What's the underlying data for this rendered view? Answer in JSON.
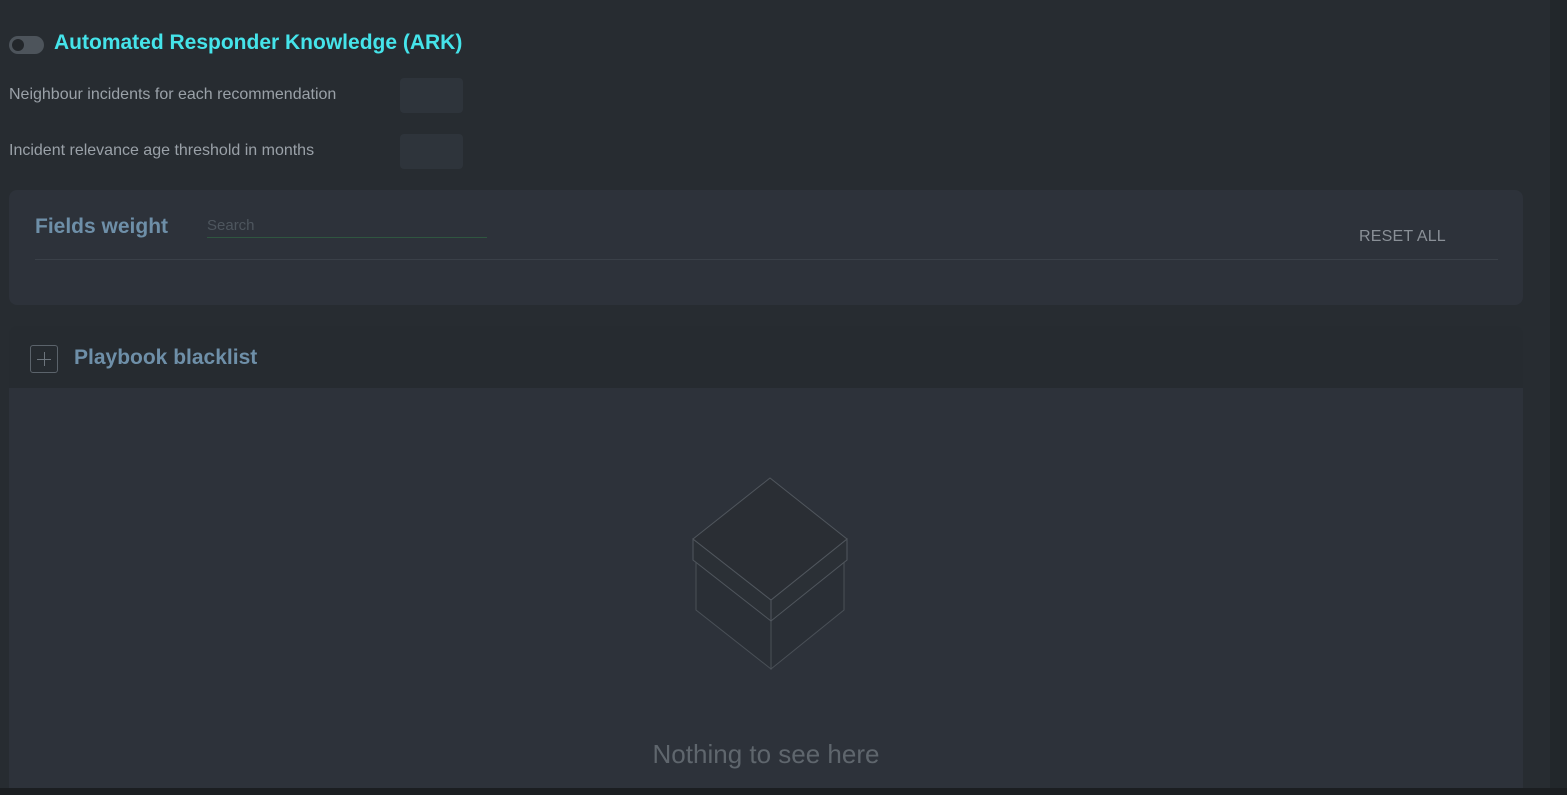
{
  "ark": {
    "title": "Automated Responder Knowledge (ARK)",
    "enabled": false,
    "settings": [
      {
        "label": "Neighbour incidents for each recommendation",
        "value": ""
      },
      {
        "label": "Incident relevance age threshold in months",
        "value": ""
      }
    ]
  },
  "fields_weight": {
    "title": "Fields weight",
    "search_placeholder": "Search",
    "reset_label": "RESET ALL"
  },
  "playbook_blacklist": {
    "title": "Playbook blacklist",
    "empty_message": "Nothing to see here",
    "empty_icon": "empty-box-icon"
  },
  "colors": {
    "accent": "#45e4ea",
    "section_title": "#6e8fa8",
    "background": "#272c31",
    "panel": "#2d323a"
  }
}
